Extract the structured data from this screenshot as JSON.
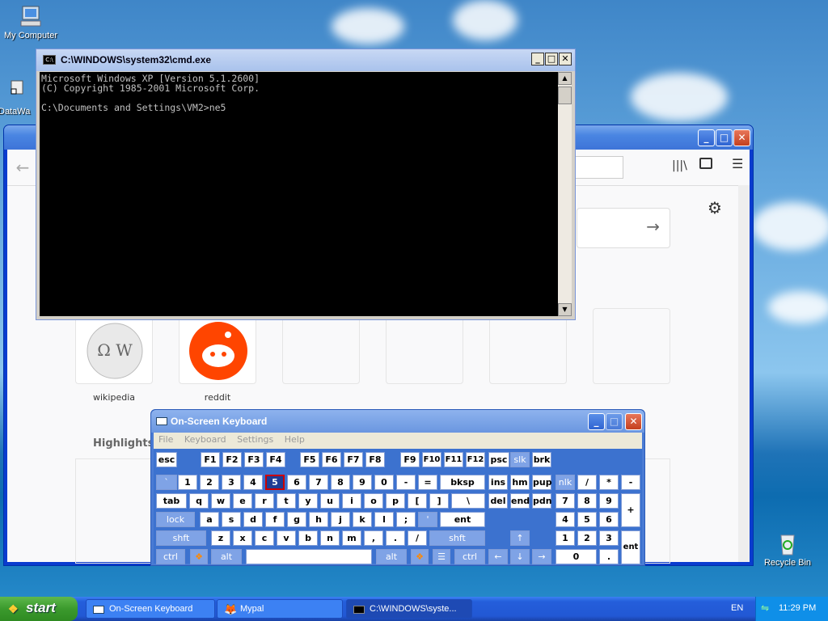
{
  "desktop": {
    "icons": [
      {
        "label": "My Computer"
      },
      {
        "label": "DataWa"
      },
      {
        "label": "Recycle Bin"
      }
    ]
  },
  "cmd": {
    "title": "C:\\WINDOWS\\system32\\cmd.exe",
    "lines": [
      "Microsoft Windows XP [Version 5.1.2600]",
      "(C) Copyright 1985-2001 Microsoft Corp.",
      "",
      "C:\\Documents and Settings\\VM2>ne5"
    ]
  },
  "browser": {
    "tiles": [
      {
        "label": "wikipedia"
      },
      {
        "label": "reddit"
      }
    ],
    "highlights_label": "Highlights"
  },
  "osk": {
    "title": "On-Screen Keyboard",
    "menu": [
      "File",
      "Keyboard",
      "Settings",
      "Help"
    ],
    "selected_key": "5"
  },
  "taskbar": {
    "start_label": "start",
    "buttons": [
      {
        "label": "On-Screen Keyboard"
      },
      {
        "label": "Mypal"
      },
      {
        "label": "C:\\WINDOWS\\syste..."
      }
    ],
    "language": "EN",
    "clock": "11:29 PM"
  },
  "colors": {
    "xp_blue": "#245edb",
    "start_green": "#3b9a2d",
    "osk_key_selected": "#1f3c94",
    "reddit_orange": "#ff4500"
  }
}
